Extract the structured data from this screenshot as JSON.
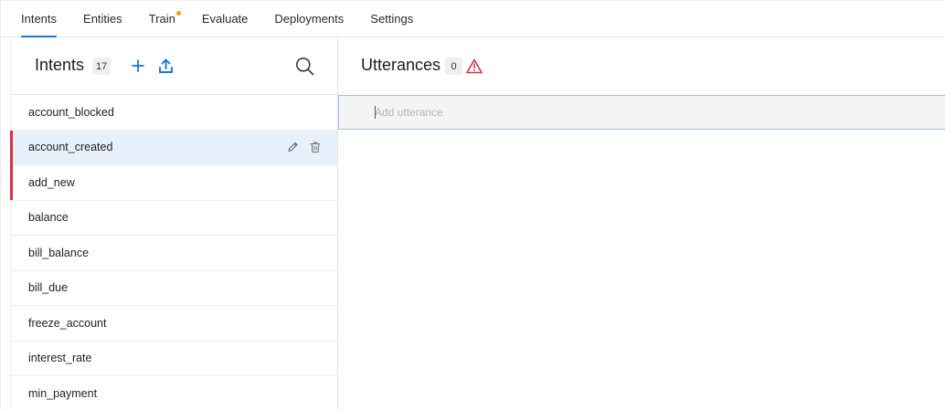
{
  "tabs": [
    {
      "label": "Intents",
      "active": true
    },
    {
      "label": "Entities"
    },
    {
      "label": "Train",
      "has_dot": true
    },
    {
      "label": "Evaluate"
    },
    {
      "label": "Deployments"
    },
    {
      "label": "Settings"
    }
  ],
  "intents_panel": {
    "title": "Intents",
    "count": "17",
    "icons": {
      "add": "plus-icon",
      "upload": "upload-icon",
      "search": "search-icon"
    }
  },
  "intents": [
    {
      "name": "account_blocked"
    },
    {
      "name": "account_created",
      "selected": true,
      "flagged": true
    },
    {
      "name": "add_new",
      "flagged": true
    },
    {
      "name": "balance"
    },
    {
      "name": "bill_balance"
    },
    {
      "name": "bill_due"
    },
    {
      "name": "freeze_account"
    },
    {
      "name": "interest_rate"
    },
    {
      "name": "min_payment"
    }
  ],
  "row_action_icons": {
    "edit": "pencil-icon",
    "delete": "trash-icon"
  },
  "utterances_panel": {
    "title": "Utterances",
    "count": "0",
    "warning_icon": "warning-icon",
    "input_value": "",
    "input_placeholder": "Add utterance"
  },
  "colors": {
    "accent": "#1a73e8",
    "flag": "#d93049",
    "warning": "#d93049",
    "train_dot": "#f29d16",
    "selected_row": "#e8f0fc"
  }
}
